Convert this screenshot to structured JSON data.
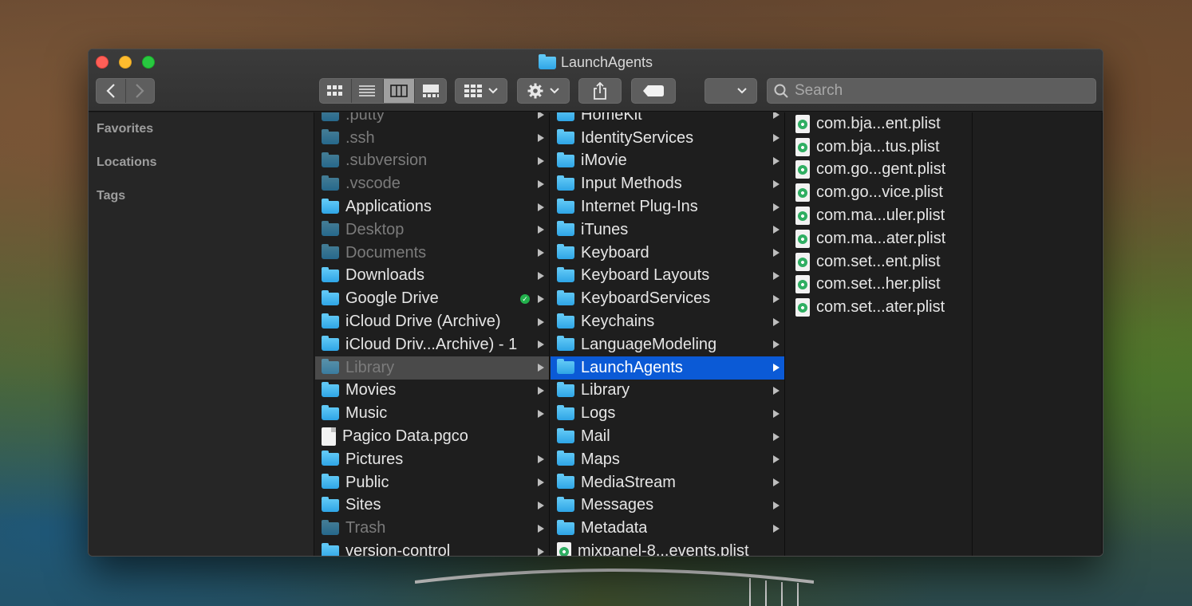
{
  "window": {
    "title": "LaunchAgents"
  },
  "toolbar": {
    "back_icon": "chevron-left-icon",
    "forward_icon": "chevron-right-icon",
    "views": [
      "icon-view",
      "list-view",
      "column-view",
      "gallery-view"
    ],
    "active_view": "column-view",
    "search_placeholder": "Search"
  },
  "sidebar": {
    "sections": [
      "Favorites",
      "Locations",
      "Tags"
    ]
  },
  "column1": [
    {
      "name": ".putty",
      "dim": true,
      "chevron": true
    },
    {
      "name": ".ssh",
      "dim": true,
      "chevron": true
    },
    {
      "name": ".subversion",
      "dim": true,
      "chevron": true
    },
    {
      "name": ".vscode",
      "dim": true,
      "chevron": true
    },
    {
      "name": "Applications",
      "chevron": true
    },
    {
      "name": "Desktop",
      "dim": true,
      "chevron": true
    },
    {
      "name": "Documents",
      "dim": true,
      "chevron": true
    },
    {
      "name": "Downloads",
      "chevron": true
    },
    {
      "name": "Google Drive",
      "chevron": true,
      "synced": true
    },
    {
      "name": "iCloud Drive (Archive)",
      "chevron": true
    },
    {
      "name": "iCloud Driv...Archive) - 1",
      "chevron": true
    },
    {
      "name": "Library",
      "dim": true,
      "chevron": true,
      "selected": "gray"
    },
    {
      "name": "Movies",
      "chevron": true
    },
    {
      "name": "Music",
      "chevron": true
    },
    {
      "name": "Pagico Data.pgco",
      "type": "doc"
    },
    {
      "name": "Pictures",
      "chevron": true
    },
    {
      "name": "Public",
      "chevron": true
    },
    {
      "name": "Sites",
      "chevron": true
    },
    {
      "name": "Trash",
      "dim": true,
      "chevron": true
    },
    {
      "name": "version-control",
      "chevron": true
    }
  ],
  "column2": [
    {
      "name": "HomeKit",
      "chevron": true
    },
    {
      "name": "IdentityServices",
      "chevron": true
    },
    {
      "name": "iMovie",
      "chevron": true
    },
    {
      "name": "Input Methods",
      "chevron": true
    },
    {
      "name": "Internet Plug-Ins",
      "chevron": true
    },
    {
      "name": "iTunes",
      "chevron": true
    },
    {
      "name": "Keyboard",
      "chevron": true
    },
    {
      "name": "Keyboard Layouts",
      "chevron": true
    },
    {
      "name": "KeyboardServices",
      "chevron": true
    },
    {
      "name": "Keychains",
      "chevron": true
    },
    {
      "name": "LanguageModeling",
      "chevron": true
    },
    {
      "name": "LaunchAgents",
      "chevron": true,
      "selected": "blue"
    },
    {
      "name": "Library",
      "chevron": true
    },
    {
      "name": "Logs",
      "chevron": true
    },
    {
      "name": "Mail",
      "chevron": true
    },
    {
      "name": "Maps",
      "chevron": true
    },
    {
      "name": "MediaStream",
      "chevron": true
    },
    {
      "name": "Messages",
      "chevron": true
    },
    {
      "name": "Metadata",
      "chevron": true
    },
    {
      "name": "mixpanel-8...events.plist",
      "type": "plist"
    }
  ],
  "column3": [
    {
      "name": "com.bja...ent.plist",
      "type": "plist"
    },
    {
      "name": "com.bja...tus.plist",
      "type": "plist"
    },
    {
      "name": "com.go...gent.plist",
      "type": "plist"
    },
    {
      "name": "com.go...vice.plist",
      "type": "plist"
    },
    {
      "name": "com.ma...uler.plist",
      "type": "plist"
    },
    {
      "name": "com.ma...ater.plist",
      "type": "plist"
    },
    {
      "name": "com.set...ent.plist",
      "type": "plist"
    },
    {
      "name": "com.set...her.plist",
      "type": "plist"
    },
    {
      "name": "com.set...ater.plist",
      "type": "plist"
    }
  ]
}
